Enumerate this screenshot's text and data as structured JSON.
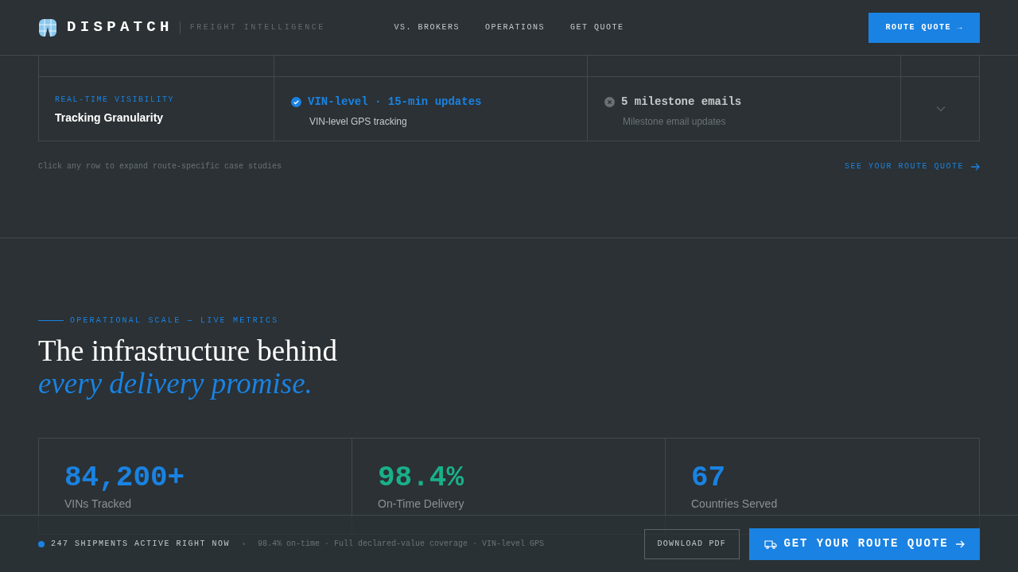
{
  "header": {
    "brand": "DISPATCH",
    "tagline": "FREIGHT INTELLIGENCE",
    "nav": [
      {
        "label": "VS. BROKERS"
      },
      {
        "label": "OPERATIONS"
      },
      {
        "label": "GET QUOTE"
      }
    ],
    "cta": "ROUTE QUOTE →"
  },
  "comparison": {
    "rows": [
      {
        "eyebrow": "REAL-TIME VISIBILITY",
        "label": "Tracking Granularity",
        "ours": {
          "title": "VIN-level · 15-min updates",
          "detail": "VIN-level GPS tracking",
          "kind": "check"
        },
        "theirs": {
          "title": "5 milestone emails",
          "detail": "Milestone email updates",
          "kind": "cross"
        },
        "expanded": false
      }
    ],
    "hint": "Click any row to expand route-specific case studies",
    "link": "SEE YOUR ROUTE QUOTE"
  },
  "metrics": {
    "eyebrow": "OPERATIONAL SCALE — LIVE METRICS",
    "heading": "The infrastructure behind",
    "heading_accent": "every delivery promise.",
    "stats": [
      {
        "value": "84,200+",
        "label": "VINs Tracked",
        "color": "#1a82e2"
      },
      {
        "value": "98.4%",
        "label": "On-Time Delivery",
        "color": "#19b08a"
      },
      {
        "value": "67",
        "label": "Countries Served",
        "color": "#1a82e2"
      }
    ]
  },
  "bottom_bar": {
    "status": "247 SHIPMENTS ACTIVE RIGHT NOW",
    "summary": "98.4% on-time · Full declared-value coverage · VIN-level GPS",
    "secondary": "DOWNLOAD PDF",
    "primary": "GET YOUR ROUTE QUOTE"
  }
}
